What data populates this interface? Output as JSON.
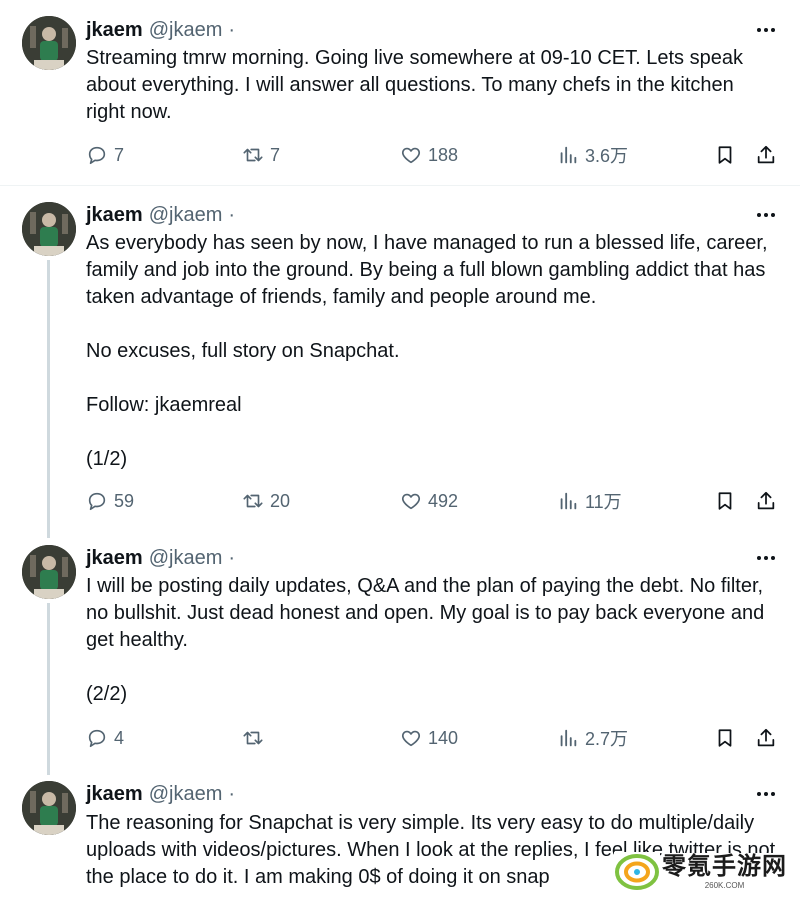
{
  "tweets": [
    {
      "name": "jkaem",
      "handle": "@jkaem",
      "dot": "·",
      "time": "",
      "text": "Streaming tmrw morning. Going live somewhere at 09-10 CET. Lets speak about everything. I will answer all questions. To many chefs in the kitchen right now.",
      "replies": "7",
      "retweets": "7",
      "likes": "188",
      "views": "3.6万"
    },
    {
      "name": "jkaem",
      "handle": "@jkaem",
      "dot": "·",
      "time": "",
      "text": "As everybody has seen by now, I have managed to run a blessed life, career, family and job into the ground. By being a full blown gambling addict that has taken advantage of friends, family and people around me.\n\nNo excuses, full story on Snapchat.\n\nFollow: jkaemreal\n\n(1/2)",
      "replies": "59",
      "retweets": "20",
      "likes": "492",
      "views": "11万"
    },
    {
      "name": "jkaem",
      "handle": "@jkaem",
      "dot": "·",
      "time": "",
      "text": "I will be posting daily updates, Q&A and the plan of paying the debt. No filter, no bullshit. Just dead honest and open. My goal is to pay back everyone and get healthy.\n\n(2/2)",
      "replies": "4",
      "retweets": "",
      "likes": "140",
      "views": "2.7万"
    },
    {
      "name": "jkaem",
      "handle": "@jkaem",
      "dot": "·",
      "time": "",
      "text": "The reasoning for Snapchat is very simple. Its very easy to do multiple/daily uploads with videos/pictures. When I look at the replies, I feel like twitter is not the place to do it. I am making 0$ of doing it on snap"
    }
  ],
  "watermark": {
    "title": "零氪手游网",
    "sub": "260K.COM"
  },
  "colors": {
    "text": "#0f1419",
    "muted": "#536471",
    "thread_line": "#cfd9de",
    "separator": "#eff3f4"
  },
  "icons": [
    "reply-icon",
    "retweet-icon",
    "like-icon",
    "views-icon",
    "bookmark-icon",
    "share-icon",
    "more-icon"
  ]
}
